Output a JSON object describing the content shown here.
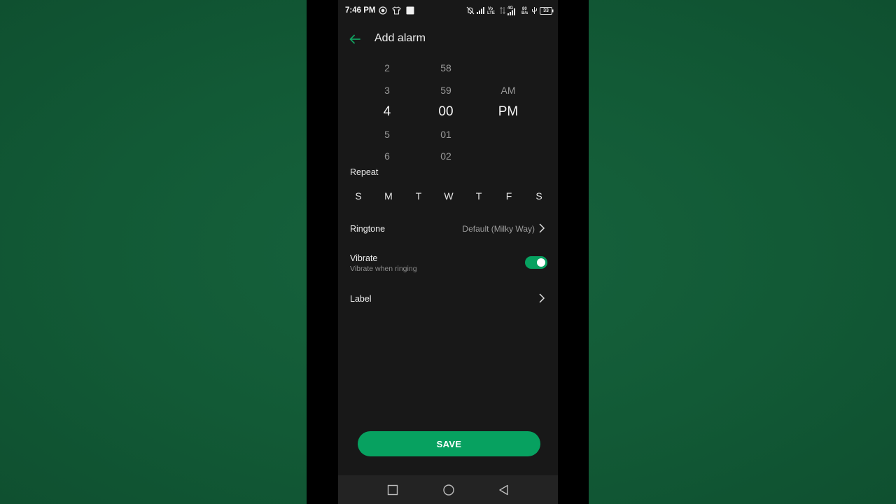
{
  "status_bar": {
    "time": "7:46 PM",
    "volte_top": "Vo",
    "volte_bottom": "LTE",
    "network_type": "4G",
    "speed_value": "80",
    "speed_unit": "B/s",
    "battery": "33"
  },
  "header": {
    "title": "Add alarm"
  },
  "time_picker": {
    "hours": [
      "2",
      "3",
      "4",
      "5",
      "6"
    ],
    "minutes": [
      "58",
      "59",
      "00",
      "01",
      "02"
    ],
    "periods": [
      "",
      "AM",
      "PM",
      "",
      ""
    ]
  },
  "repeat": {
    "label": "Repeat",
    "days": [
      "S",
      "M",
      "T",
      "W",
      "T",
      "F",
      "S"
    ]
  },
  "ringtone": {
    "label": "Ringtone",
    "value": "Default (Milky Way)"
  },
  "vibrate": {
    "label": "Vibrate",
    "sublabel": "Vibrate when ringing",
    "enabled": true
  },
  "label_row": {
    "label": "Label"
  },
  "save_label": "SAVE",
  "colors": {
    "accent": "#07a160",
    "screen_bg": "#181818",
    "nav_bg": "#232323"
  }
}
